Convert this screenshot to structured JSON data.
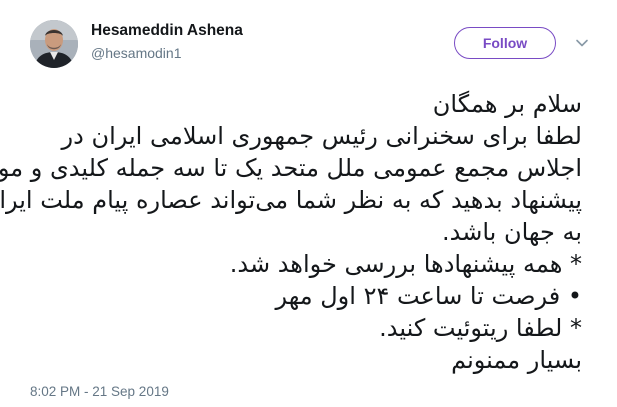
{
  "tweet": {
    "author": {
      "display_name": "Hesameddin Ashena",
      "handle": "@hesamodin1"
    },
    "follow_label": "Follow",
    "lines": [
      "سلام بر همگان",
      "لطفا برای سخنرانی رئیس جمهوری اسلامی ایران در",
      "اجلاس مجمع عمومی ملل متحد یک تا سه جمله کلیدی و موثر",
      "پیشنهاد بدهید که به نظر شما می‌تواند عصاره پیام ملت ایران",
      "به جهان باشد.",
      "* همه پیشنهادها بررسی خواهد شد.",
      "• فرصت  تا ساعت ۲۴ اول مهر",
      "* لطفا ریتوئیت کنید.",
      "بسیار ممنونم"
    ],
    "timestamp": "8:02 PM - 21 Sep 2019"
  },
  "colors": {
    "accent": "#794bc4",
    "text": "#14171a",
    "secondary_text": "#657786"
  },
  "icons": {
    "caret": "chevron-down-icon"
  }
}
